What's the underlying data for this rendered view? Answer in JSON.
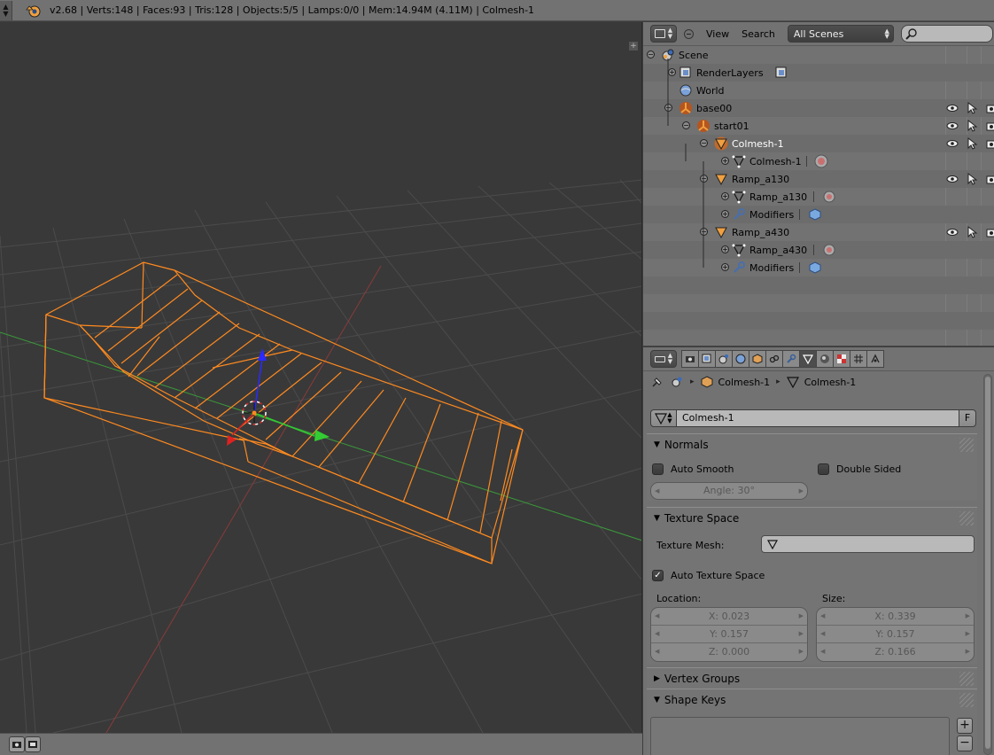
{
  "info_bar": {
    "stats": "v2.68 | Verts:148 | Faces:93 | Tris:128 | Objects:5/5 | Lamps:0/0 | Mem:14.94M (4.11M) | Colmesh-1"
  },
  "outliner": {
    "header": {
      "view_menu": "View",
      "search_menu": "Search",
      "scene_filter": "All Scenes",
      "search_placeholder": ""
    },
    "rows": [
      {
        "label": "Scene",
        "icon": "scene-icon",
        "indent": 0,
        "expander": "minus"
      },
      {
        "label": "RenderLayers",
        "icon": "render-layers-icon",
        "indent": 1,
        "expander": "plus"
      },
      {
        "label": "World",
        "icon": "world-icon",
        "indent": 1,
        "expander": "none"
      },
      {
        "label": "base00",
        "icon": "empty-icon",
        "indent": 1,
        "expander": "minus"
      },
      {
        "label": "start01",
        "icon": "empty-icon",
        "indent": 2,
        "expander": "minus"
      },
      {
        "label": "Colmesh-1",
        "icon": "mesh-object-icon",
        "indent": 3,
        "expander": "minus",
        "selected": true
      },
      {
        "label": "Colmesh-1",
        "icon": "mesh-data-icon",
        "indent": 4,
        "expander": "plus"
      },
      {
        "label": "Ramp_a130",
        "icon": "mesh-object-icon",
        "indent": 3,
        "expander": "minus"
      },
      {
        "label": "Ramp_a130",
        "icon": "mesh-data-icon",
        "indent": 4,
        "expander": "plus"
      },
      {
        "label": "Modifiers",
        "icon": "wrench-icon",
        "indent": 4,
        "expander": "plus"
      },
      {
        "label": "Ramp_a430",
        "icon": "mesh-object-icon",
        "indent": 3,
        "expander": "minus"
      },
      {
        "label": "Ramp_a430",
        "icon": "mesh-data-icon",
        "indent": 4,
        "expander": "plus"
      },
      {
        "label": "Modifiers",
        "icon": "wrench-icon",
        "indent": 4,
        "expander": "plus"
      }
    ]
  },
  "properties": {
    "breadcrumb": {
      "object": "Colmesh-1",
      "mesh": "Colmesh-1"
    },
    "datablock": {
      "name": "Colmesh-1",
      "fake_user": "F"
    },
    "normals": {
      "title": "Normals",
      "auto_smooth": "Auto Smooth",
      "double_sided": "Double Sided",
      "angle": "Angle: 30°"
    },
    "texture_space": {
      "title": "Texture Space",
      "texture_mesh_label": "Texture Mesh:",
      "auto_texture_space": "Auto Texture Space",
      "location_label": "Location:",
      "size_label": "Size:",
      "location": {
        "x": "X: 0.023",
        "y": "Y: 0.157",
        "z": "Z: 0.000"
      },
      "size": {
        "x": "X: 0.339",
        "y": "Y: 0.157",
        "z": "Z: 0.166"
      }
    },
    "vertex_groups": {
      "title": "Vertex Groups"
    },
    "shape_keys": {
      "title": "Shape Keys",
      "add": "+",
      "remove": "−"
    }
  },
  "colors": {
    "selection_orange": "#ff8a1f",
    "grid_line": "#4a4a4a",
    "x_axis": "#b84040",
    "y_axis": "#3cb43c"
  }
}
